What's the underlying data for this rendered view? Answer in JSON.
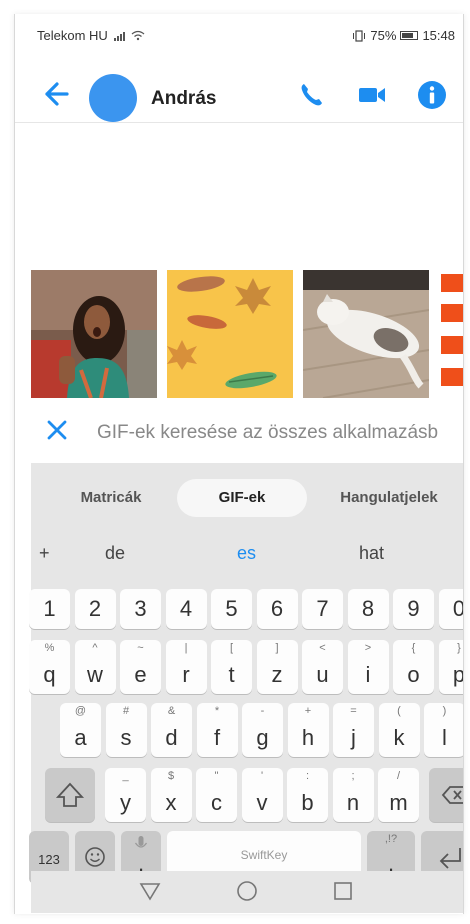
{
  "status": {
    "carrier": "Telekom HU",
    "battery": "75%",
    "time": "15:48"
  },
  "header": {
    "contact_name": "András",
    "accent": "#1d8df0"
  },
  "gif_strip": {
    "items": [
      "surprised-woman-gif",
      "autumn-leaves-gif",
      "sleeping-cat-gif",
      "red-stripes-gif"
    ]
  },
  "search": {
    "placeholder": "GIF-ek keresése az összes alkalmazásb"
  },
  "keyboard": {
    "tabs": [
      "Matricák",
      "GIF-ek",
      "Hangulatjelek"
    ],
    "active_tab": "GIF-ek",
    "suggestions": {
      "plus": "+",
      "left": "de",
      "center": "es",
      "right": "hat"
    },
    "numbers": [
      "1",
      "2",
      "3",
      "4",
      "5",
      "6",
      "7",
      "8",
      "9",
      "0"
    ],
    "row1": [
      {
        "main": "q",
        "sub": "%"
      },
      {
        "main": "w",
        "sub": "^"
      },
      {
        "main": "e",
        "sub": "~"
      },
      {
        "main": "r",
        "sub": "|"
      },
      {
        "main": "t",
        "sub": "["
      },
      {
        "main": "z",
        "sub": "]"
      },
      {
        "main": "u",
        "sub": "<"
      },
      {
        "main": "i",
        "sub": ">"
      },
      {
        "main": "o",
        "sub": "{"
      },
      {
        "main": "p",
        "sub": "}"
      }
    ],
    "row2": [
      {
        "main": "a",
        "sub": "@"
      },
      {
        "main": "s",
        "sub": "#"
      },
      {
        "main": "d",
        "sub": "&"
      },
      {
        "main": "f",
        "sub": "*"
      },
      {
        "main": "g",
        "sub": "-"
      },
      {
        "main": "h",
        "sub": "+"
      },
      {
        "main": "j",
        "sub": "="
      },
      {
        "main": "k",
        "sub": "("
      },
      {
        "main": "l",
        "sub": ")"
      }
    ],
    "row3": [
      {
        "main": "y",
        "sub": "_"
      },
      {
        "main": "x",
        "sub": "$"
      },
      {
        "main": "c",
        "sub": "\""
      },
      {
        "main": "v",
        "sub": "'"
      },
      {
        "main": "b",
        "sub": ":"
      },
      {
        "main": "n",
        "sub": ";"
      },
      {
        "main": "m",
        "sub": "/"
      }
    ],
    "num_key": "123",
    "comma_key": ",",
    "space_label": "SwiftKey",
    "period_key": ".",
    "period_sub": ",!?"
  }
}
